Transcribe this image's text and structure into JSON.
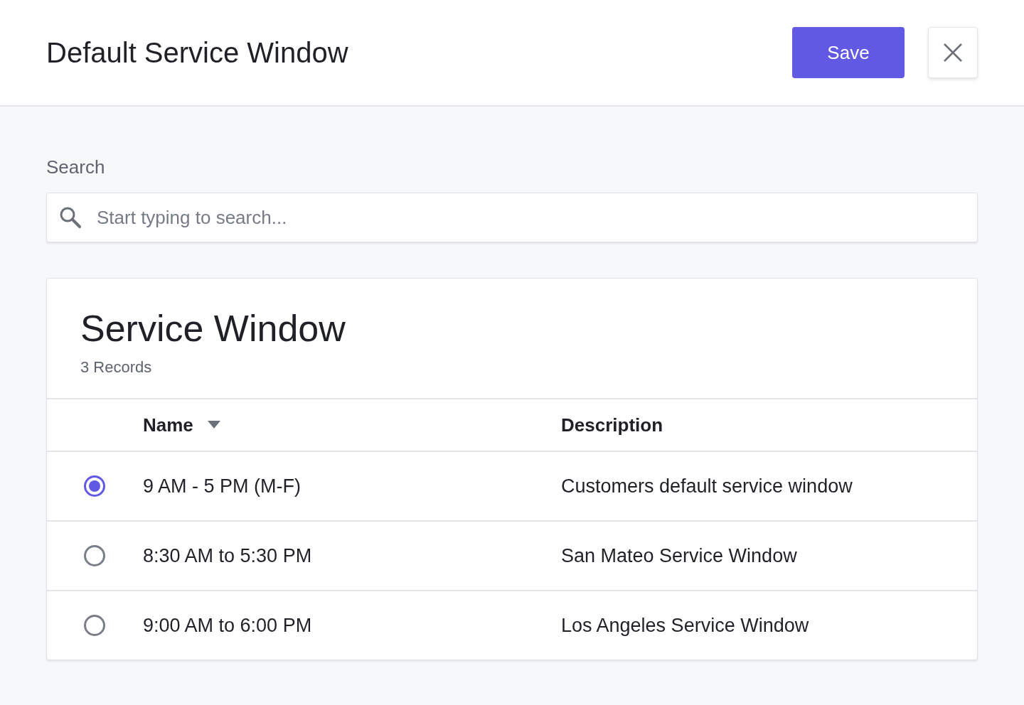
{
  "header": {
    "title": "Default Service Window",
    "save_label": "Save"
  },
  "search": {
    "label": "Search",
    "placeholder": "Start typing to search..."
  },
  "table": {
    "title": "Service Window",
    "count": "3 Records",
    "columns": [
      {
        "label": "Name",
        "sorted": true
      },
      {
        "label": "Description",
        "sorted": false
      }
    ],
    "rows": [
      {
        "name": "9 AM - 5 PM (M-F)",
        "description": "Customers default service window",
        "selected": true
      },
      {
        "name": "8:30 AM to 5:30 PM",
        "description": "San Mateo Service Window",
        "selected": false
      },
      {
        "name": "9:00 AM to 6:00 PM",
        "description": "Los Angeles Service Window",
        "selected": false
      }
    ]
  }
}
